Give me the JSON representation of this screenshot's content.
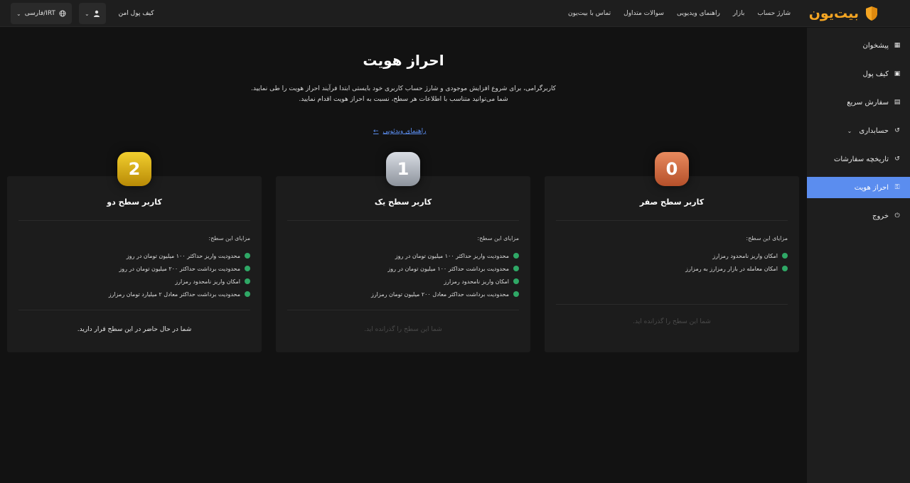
{
  "brand": {
    "name": "بیت‌یون",
    "accent": "#f5a623"
  },
  "nav": [
    "شارژ حساب",
    "بازار",
    "راهنمای ویدیویی",
    "سوالات متداول",
    "تماس با بیت‌یون"
  ],
  "header": {
    "wallet_label": "کیف پول امن",
    "language": "فارسی/IRT"
  },
  "sidebar": {
    "items": [
      {
        "label": "پیشخوان",
        "icon": "dashboard-icon"
      },
      {
        "label": "کیف پول",
        "icon": "wallet-icon"
      },
      {
        "label": "سفارش سریع",
        "icon": "document-icon"
      },
      {
        "label": "حسابداری",
        "icon": "history-icon"
      },
      {
        "label": "تاریخچه سفارشات",
        "icon": "history-icon"
      },
      {
        "label": "احراز هویت",
        "icon": "key-icon"
      },
      {
        "label": "خروج",
        "icon": "power-icon"
      }
    ],
    "active_color": "#5b8def"
  },
  "main": {
    "title": "احراز هویت",
    "intro_line1": "کاربرگرامی، برای شروع افزایش موجودی و شارژ حساب کاربری خود بایستی ابتدا فرآیند احراز هویت را طی نمایید.",
    "intro_line2": "شما می‌توانید متناسب با اطلاعات هر سطح، نسبت به احراز هویت اقدام نمایید.",
    "video_link": "راهنمای ویدئویی"
  },
  "levels": [
    {
      "badge": "0",
      "title": "کاربر سطح صفر",
      "benefits_head": "مزایای این سطح:",
      "benefits": [
        "امکان واریز نامحدود رمزارز",
        "امکان معامله در بازار رمزارز به رمزارز"
      ],
      "status": "شما این سطح را گذرانده اید."
    },
    {
      "badge": "1",
      "title": "کاربر سطح یک",
      "benefits_head": "مزایای این سطح:",
      "benefits": [
        "محدودیت واریز حداکثر ۱۰۰ میلیون تومان در روز",
        "محدودیت برداشت حداکثر ۱۰۰ میلیون تومان در روز",
        "امکان واریز نامحدود رمزارز",
        "محدودیت برداشت حداکثر معادل ۲۰۰ میلیون تومان رمزارز"
      ],
      "status": "شما این سطح را گذرانده اید."
    },
    {
      "badge": "2",
      "title": "کاربر سطح دو",
      "benefits_head": "مزایای این سطح:",
      "benefits": [
        "محدودیت واریز حداکثر ۱۰۰ میلیون تومان در روز",
        "محدودیت برداشت حداکثر ۲۰۰ میلیون تومان در روز",
        "امکان واریز نامحدود رمزارز",
        "محدودیت برداشت حداکثر معادل ۲ میلیارد تومان رمزارز"
      ],
      "status": "شما در حال حاضر در این سطح قرار دارید."
    }
  ]
}
